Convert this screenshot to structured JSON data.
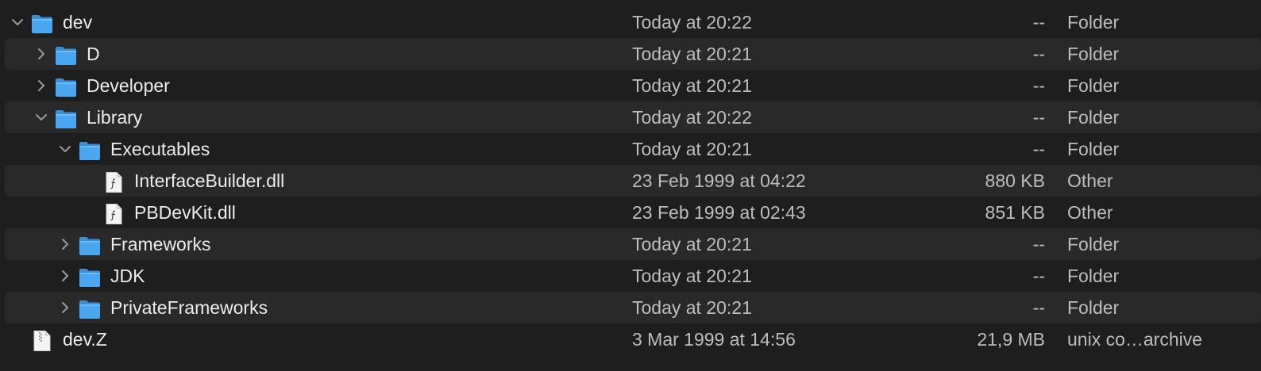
{
  "rows": [
    {
      "name": "dev",
      "date": "Today at 20:22",
      "size": "--",
      "kind": "Folder",
      "level": 0,
      "type": "folder",
      "disclosure": "expanded"
    },
    {
      "name": "D",
      "date": "Today at 20:21",
      "size": "--",
      "kind": "Folder",
      "level": 1,
      "type": "folder",
      "disclosure": "collapsed"
    },
    {
      "name": "Developer",
      "date": "Today at 20:21",
      "size": "--",
      "kind": "Folder",
      "level": 1,
      "type": "folder",
      "disclosure": "collapsed"
    },
    {
      "name": "Library",
      "date": "Today at 20:22",
      "size": "--",
      "kind": "Folder",
      "level": 1,
      "type": "folder",
      "disclosure": "expanded"
    },
    {
      "name": "Executables",
      "date": "Today at 20:21",
      "size": "--",
      "kind": "Folder",
      "level": 2,
      "type": "folder",
      "disclosure": "expanded"
    },
    {
      "name": "InterfaceBuilder.dll",
      "date": "23 Feb 1999 at 04:22",
      "size": "880 KB",
      "kind": "Other",
      "level": 3,
      "type": "file",
      "disclosure": "none"
    },
    {
      "name": "PBDevKit.dll",
      "date": "23 Feb 1999 at 02:43",
      "size": "851 KB",
      "kind": "Other",
      "level": 3,
      "type": "file",
      "disclosure": "none"
    },
    {
      "name": "Frameworks",
      "date": "Today at 20:21",
      "size": "--",
      "kind": "Folder",
      "level": 2,
      "type": "folder",
      "disclosure": "collapsed"
    },
    {
      "name": "JDK",
      "date": "Today at 20:21",
      "size": "--",
      "kind": "Folder",
      "level": 2,
      "type": "folder",
      "disclosure": "collapsed"
    },
    {
      "name": "PrivateFrameworks",
      "date": "Today at 20:21",
      "size": "--",
      "kind": "Folder",
      "level": 2,
      "type": "folder",
      "disclosure": "collapsed"
    },
    {
      "name": "dev.Z",
      "date": "3 Mar 1999 at 14:56",
      "size": "21,9 MB",
      "kind": "unix co…archive",
      "level": 0,
      "type": "archive",
      "disclosure": "none"
    }
  ],
  "colors": {
    "background": "#1e1e1e",
    "alternate_row": "#292929",
    "folder_blue": "#4aa6ee",
    "text_primary": "#ececec",
    "text_secondary": "#bdbdbd"
  }
}
